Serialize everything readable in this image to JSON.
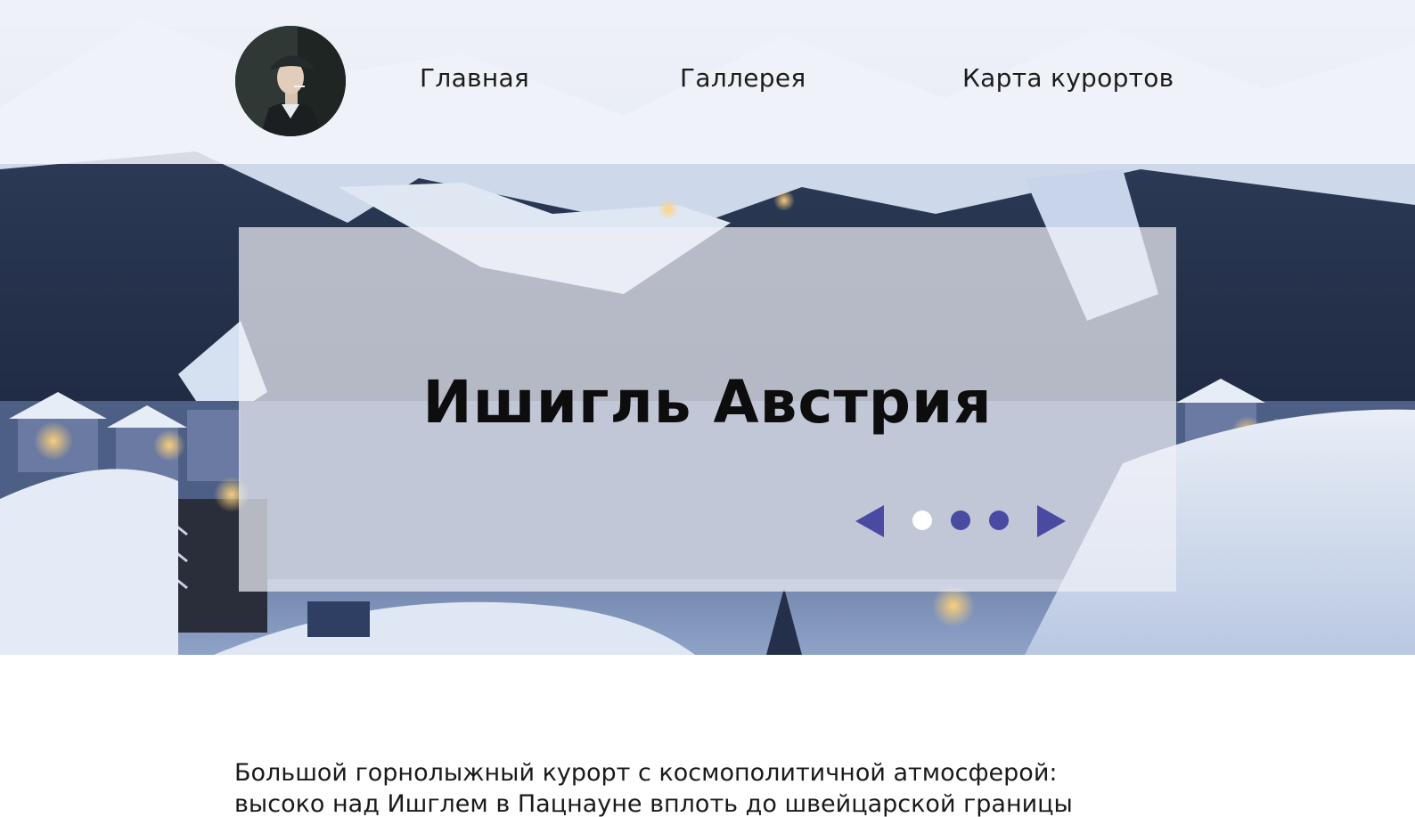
{
  "header": {
    "avatar_icon": "user-avatar-icon",
    "nav": [
      {
        "label": "Главная"
      },
      {
        "label": "Галлерея"
      },
      {
        "label": "Карта курортов"
      }
    ]
  },
  "slider": {
    "title": "Ишигль Австрия",
    "total_slides": 3,
    "active_slide": 1,
    "prev_icon": "triangle-left-icon",
    "next_icon": "triangle-right-icon",
    "colors": {
      "accent": "#4a4aa2",
      "active_dot": "#ffffff"
    }
  },
  "description": {
    "lines": [
      "Большой горнолыжный курорт с космополитичной атмосферой:",
      "высоко над Ишглем в Пацнауне вплоть до швейцарской границы"
    ]
  }
}
